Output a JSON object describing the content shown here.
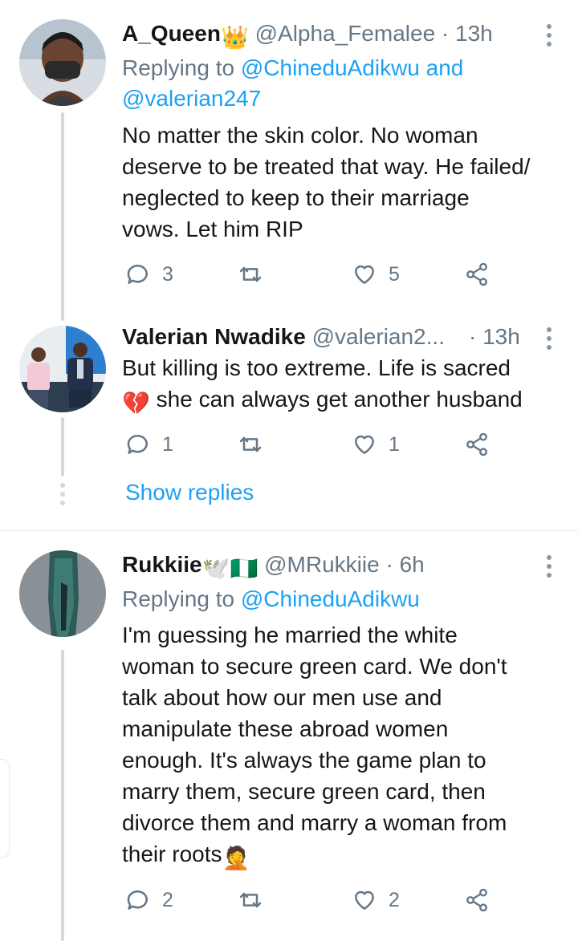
{
  "tweets": [
    {
      "name": "A_Queen",
      "name_emoji": "👑",
      "handle": "@Alpha_Femalee",
      "dot": "·",
      "time": "13h",
      "replying_prefix": "Replying to",
      "replying_to_1": "@ChineduAdikwu",
      "replying_and": "and",
      "replying_to_2": "@valerian247",
      "text_lines": [
        "No matter the skin color. No woman",
        "deserve to be treated that way. He failed/",
        "neglected to keep to their marriage",
        "vows. Let him RIP"
      ],
      "replies": "3",
      "retweets": "",
      "likes": "5"
    },
    {
      "name": "Valerian Nwadike",
      "handle": "@valerian2...",
      "dot": "·",
      "time": "13h",
      "text_line1": "But killing is too extreme. Life is sacred",
      "text_line2_emoji": "💔",
      "text_line2": "she can always get another husband",
      "replies": "1",
      "retweets": "",
      "likes": "1"
    },
    {
      "name": "Rukkiie",
      "name_emoji": "🕊️🇳🇬",
      "handle": "@MRukkiie",
      "dot": "·",
      "time": "6h",
      "replying_prefix": "Replying to",
      "replying_to_1": "@ChineduAdikwu",
      "text_lines": [
        "I'm guessing he married the white",
        "woman to secure green card. We don't",
        "talk about how our men use and",
        "manipulate these abroad women",
        "enough. It's always the game plan to",
        "marry them, secure green card, then",
        "divorce them and marry a woman from",
        "their roots"
      ],
      "last_emoji": "🤦",
      "replies": "2",
      "retweets": "",
      "likes": "2"
    }
  ],
  "show_replies": "Show replies",
  "colors": {
    "link": "#1da1f2",
    "secondary": "#657786",
    "divider": "#e1e8ed",
    "thread": "#cfd9de"
  },
  "icons": [
    "reply-icon",
    "retweet-icon",
    "like-icon",
    "share-icon",
    "more-options-icon"
  ]
}
